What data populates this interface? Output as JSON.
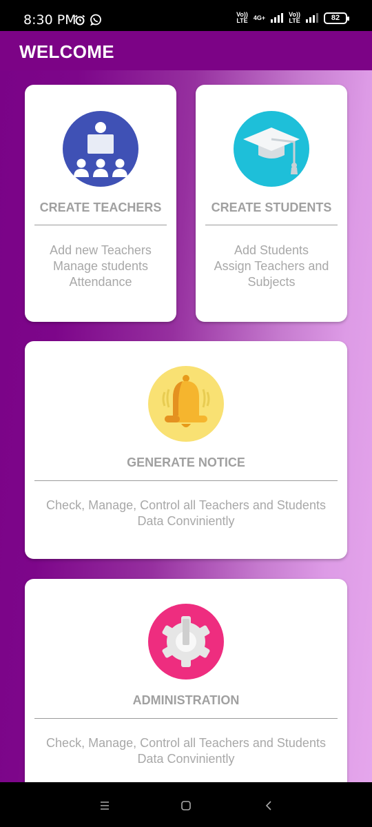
{
  "status_bar": {
    "time": "8:30 PM",
    "net1_top": "Vo))",
    "net1_bottom": "LTE",
    "net2_top": "4G+",
    "net3_top": "Vo))",
    "net3_bottom": "LTE",
    "battery": "82",
    "icons": [
      "alarm-icon",
      "whatsapp-icon",
      "signal-icon",
      "battery-icon"
    ]
  },
  "app_bar": {
    "title": "WELCOME"
  },
  "cards": {
    "create_teachers": {
      "title": "CREATE TEACHERS",
      "desc": [
        "Add new Teachers",
        "Manage students",
        "Attendance"
      ],
      "icon": "teacher-classroom-icon",
      "icon_color": "#3f51b5"
    },
    "create_students": {
      "title": "CREATE STUDENTS",
      "desc": [
        "Add Students",
        "Assign Teachers and",
        "Subjects"
      ],
      "icon": "graduation-cap-icon",
      "icon_color": "#1ebfd9"
    },
    "generate_notice": {
      "title": "GENERATE NOTICE",
      "desc": [
        "Check, Manage, Control all Teachers and Students",
        "Data Conviniently"
      ],
      "icon": "bell-icon",
      "icon_color": "#f9e173"
    },
    "administration": {
      "title": "ADMINISTRATION",
      "desc": [
        "Check, Manage, Control all Teachers and Students",
        "Data Conviniently"
      ],
      "icon": "gear-icon",
      "icon_color": "#ee2d7f"
    }
  },
  "nav_bar": {
    "icons": [
      "menu-icon",
      "home-icon",
      "back-icon"
    ]
  }
}
